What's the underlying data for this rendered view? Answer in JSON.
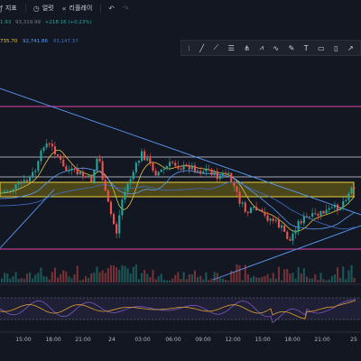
{
  "toolbar": {
    "items": [
      {
        "label": "지표",
        "icon": "indicator-icon"
      },
      {
        "label": "얼럿",
        "icon": "alert-clock-icon"
      },
      {
        "label": "리플레이",
        "icon": "replay-icon"
      }
    ],
    "undo_icon": "undo-icon",
    "redo_icon": "redo-icon"
  },
  "legend": {
    "ohlc_prefix": "1.93",
    "ohlc_value": "93,319.99",
    "ohlc_change": "+218.16 (+0.23%)",
    "ma_values": [
      "735.70",
      "92,741.86",
      "93,147.37"
    ],
    "colors": {
      "up": "#26a69a",
      "down": "#ef5350",
      "ma1": "#e0c341",
      "ma2": "#5b9cf6",
      "ma3": "#3f6ec9"
    }
  },
  "drawing_toolbar": {
    "icons": [
      "cursor-icon",
      "trendline-icon",
      "fib-icon",
      "pitchfork-icon",
      "pattern-icon",
      "wave-icon",
      "brush-icon",
      "text-icon",
      "measure-icon",
      "rectangle-icon",
      "arrow-icon"
    ]
  },
  "time_axis": {
    "labels": [
      "15:00",
      "18:00",
      "21:00",
      "24",
      "03:00",
      "06:00",
      "09:00",
      "12:00",
      "15:00",
      "18:00",
      "21:00",
      "25"
    ]
  }
}
